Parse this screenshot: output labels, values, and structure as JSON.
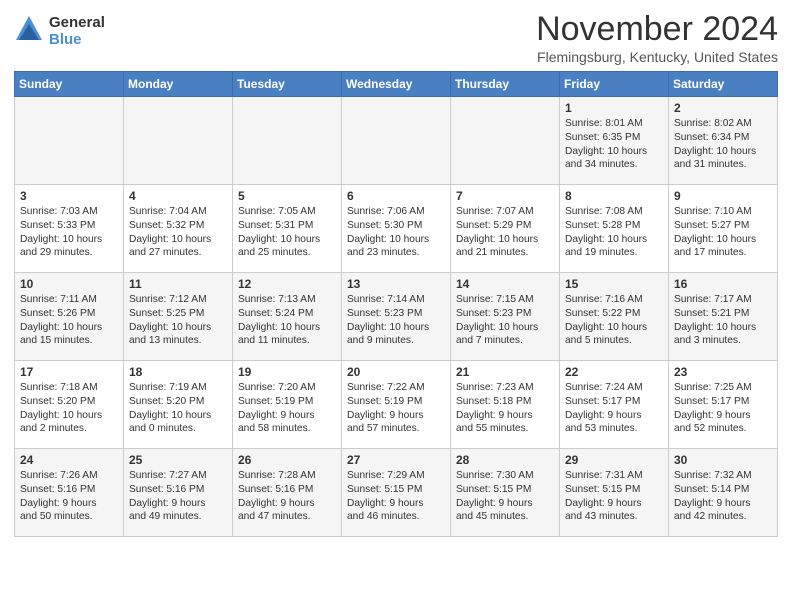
{
  "header": {
    "logo_general": "General",
    "logo_blue": "Blue",
    "month_title": "November 2024",
    "location": "Flemingsburg, Kentucky, United States"
  },
  "days_of_week": [
    "Sunday",
    "Monday",
    "Tuesday",
    "Wednesday",
    "Thursday",
    "Friday",
    "Saturday"
  ],
  "weeks": [
    [
      {
        "day": "",
        "content": ""
      },
      {
        "day": "",
        "content": ""
      },
      {
        "day": "",
        "content": ""
      },
      {
        "day": "",
        "content": ""
      },
      {
        "day": "",
        "content": ""
      },
      {
        "day": "1",
        "content": "Sunrise: 8:01 AM\nSunset: 6:35 PM\nDaylight: 10 hours\nand 34 minutes."
      },
      {
        "day": "2",
        "content": "Sunrise: 8:02 AM\nSunset: 6:34 PM\nDaylight: 10 hours\nand 31 minutes."
      }
    ],
    [
      {
        "day": "3",
        "content": "Sunrise: 7:03 AM\nSunset: 5:33 PM\nDaylight: 10 hours\nand 29 minutes."
      },
      {
        "day": "4",
        "content": "Sunrise: 7:04 AM\nSunset: 5:32 PM\nDaylight: 10 hours\nand 27 minutes."
      },
      {
        "day": "5",
        "content": "Sunrise: 7:05 AM\nSunset: 5:31 PM\nDaylight: 10 hours\nand 25 minutes."
      },
      {
        "day": "6",
        "content": "Sunrise: 7:06 AM\nSunset: 5:30 PM\nDaylight: 10 hours\nand 23 minutes."
      },
      {
        "day": "7",
        "content": "Sunrise: 7:07 AM\nSunset: 5:29 PM\nDaylight: 10 hours\nand 21 minutes."
      },
      {
        "day": "8",
        "content": "Sunrise: 7:08 AM\nSunset: 5:28 PM\nDaylight: 10 hours\nand 19 minutes."
      },
      {
        "day": "9",
        "content": "Sunrise: 7:10 AM\nSunset: 5:27 PM\nDaylight: 10 hours\nand 17 minutes."
      }
    ],
    [
      {
        "day": "10",
        "content": "Sunrise: 7:11 AM\nSunset: 5:26 PM\nDaylight: 10 hours\nand 15 minutes."
      },
      {
        "day": "11",
        "content": "Sunrise: 7:12 AM\nSunset: 5:25 PM\nDaylight: 10 hours\nand 13 minutes."
      },
      {
        "day": "12",
        "content": "Sunrise: 7:13 AM\nSunset: 5:24 PM\nDaylight: 10 hours\nand 11 minutes."
      },
      {
        "day": "13",
        "content": "Sunrise: 7:14 AM\nSunset: 5:23 PM\nDaylight: 10 hours\nand 9 minutes."
      },
      {
        "day": "14",
        "content": "Sunrise: 7:15 AM\nSunset: 5:23 PM\nDaylight: 10 hours\nand 7 minutes."
      },
      {
        "day": "15",
        "content": "Sunrise: 7:16 AM\nSunset: 5:22 PM\nDaylight: 10 hours\nand 5 minutes."
      },
      {
        "day": "16",
        "content": "Sunrise: 7:17 AM\nSunset: 5:21 PM\nDaylight: 10 hours\nand 3 minutes."
      }
    ],
    [
      {
        "day": "17",
        "content": "Sunrise: 7:18 AM\nSunset: 5:20 PM\nDaylight: 10 hours\nand 2 minutes."
      },
      {
        "day": "18",
        "content": "Sunrise: 7:19 AM\nSunset: 5:20 PM\nDaylight: 10 hours\nand 0 minutes."
      },
      {
        "day": "19",
        "content": "Sunrise: 7:20 AM\nSunset: 5:19 PM\nDaylight: 9 hours\nand 58 minutes."
      },
      {
        "day": "20",
        "content": "Sunrise: 7:22 AM\nSunset: 5:19 PM\nDaylight: 9 hours\nand 57 minutes."
      },
      {
        "day": "21",
        "content": "Sunrise: 7:23 AM\nSunset: 5:18 PM\nDaylight: 9 hours\nand 55 minutes."
      },
      {
        "day": "22",
        "content": "Sunrise: 7:24 AM\nSunset: 5:17 PM\nDaylight: 9 hours\nand 53 minutes."
      },
      {
        "day": "23",
        "content": "Sunrise: 7:25 AM\nSunset: 5:17 PM\nDaylight: 9 hours\nand 52 minutes."
      }
    ],
    [
      {
        "day": "24",
        "content": "Sunrise: 7:26 AM\nSunset: 5:16 PM\nDaylight: 9 hours\nand 50 minutes."
      },
      {
        "day": "25",
        "content": "Sunrise: 7:27 AM\nSunset: 5:16 PM\nDaylight: 9 hours\nand 49 minutes."
      },
      {
        "day": "26",
        "content": "Sunrise: 7:28 AM\nSunset: 5:16 PM\nDaylight: 9 hours\nand 47 minutes."
      },
      {
        "day": "27",
        "content": "Sunrise: 7:29 AM\nSunset: 5:15 PM\nDaylight: 9 hours\nand 46 minutes."
      },
      {
        "day": "28",
        "content": "Sunrise: 7:30 AM\nSunset: 5:15 PM\nDaylight: 9 hours\nand 45 minutes."
      },
      {
        "day": "29",
        "content": "Sunrise: 7:31 AM\nSunset: 5:15 PM\nDaylight: 9 hours\nand 43 minutes."
      },
      {
        "day": "30",
        "content": "Sunrise: 7:32 AM\nSunset: 5:14 PM\nDaylight: 9 hours\nand 42 minutes."
      }
    ]
  ]
}
